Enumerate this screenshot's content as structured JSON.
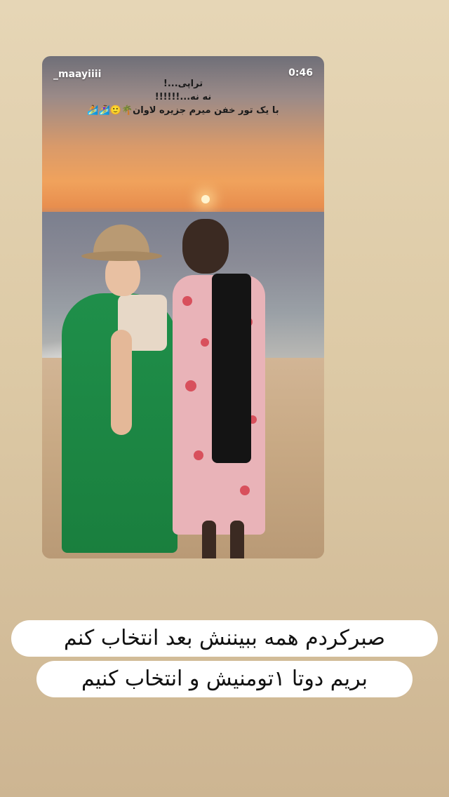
{
  "story_card": {
    "username": "_maayiiii",
    "time": "0:46",
    "caption_lines": [
      "تراپی...!",
      "نه نه...!!!!!!",
      "با یک تور خفن میرم جزیره لاوان🌴🙂🏄‍♀️🏄"
    ]
  },
  "overlay_text": {
    "line1": "صبرکردم همه ببیننش بعد انتخاب کنم",
    "line2": "بریم دوتا ۱تومنیش و انتخاب کنیم"
  }
}
